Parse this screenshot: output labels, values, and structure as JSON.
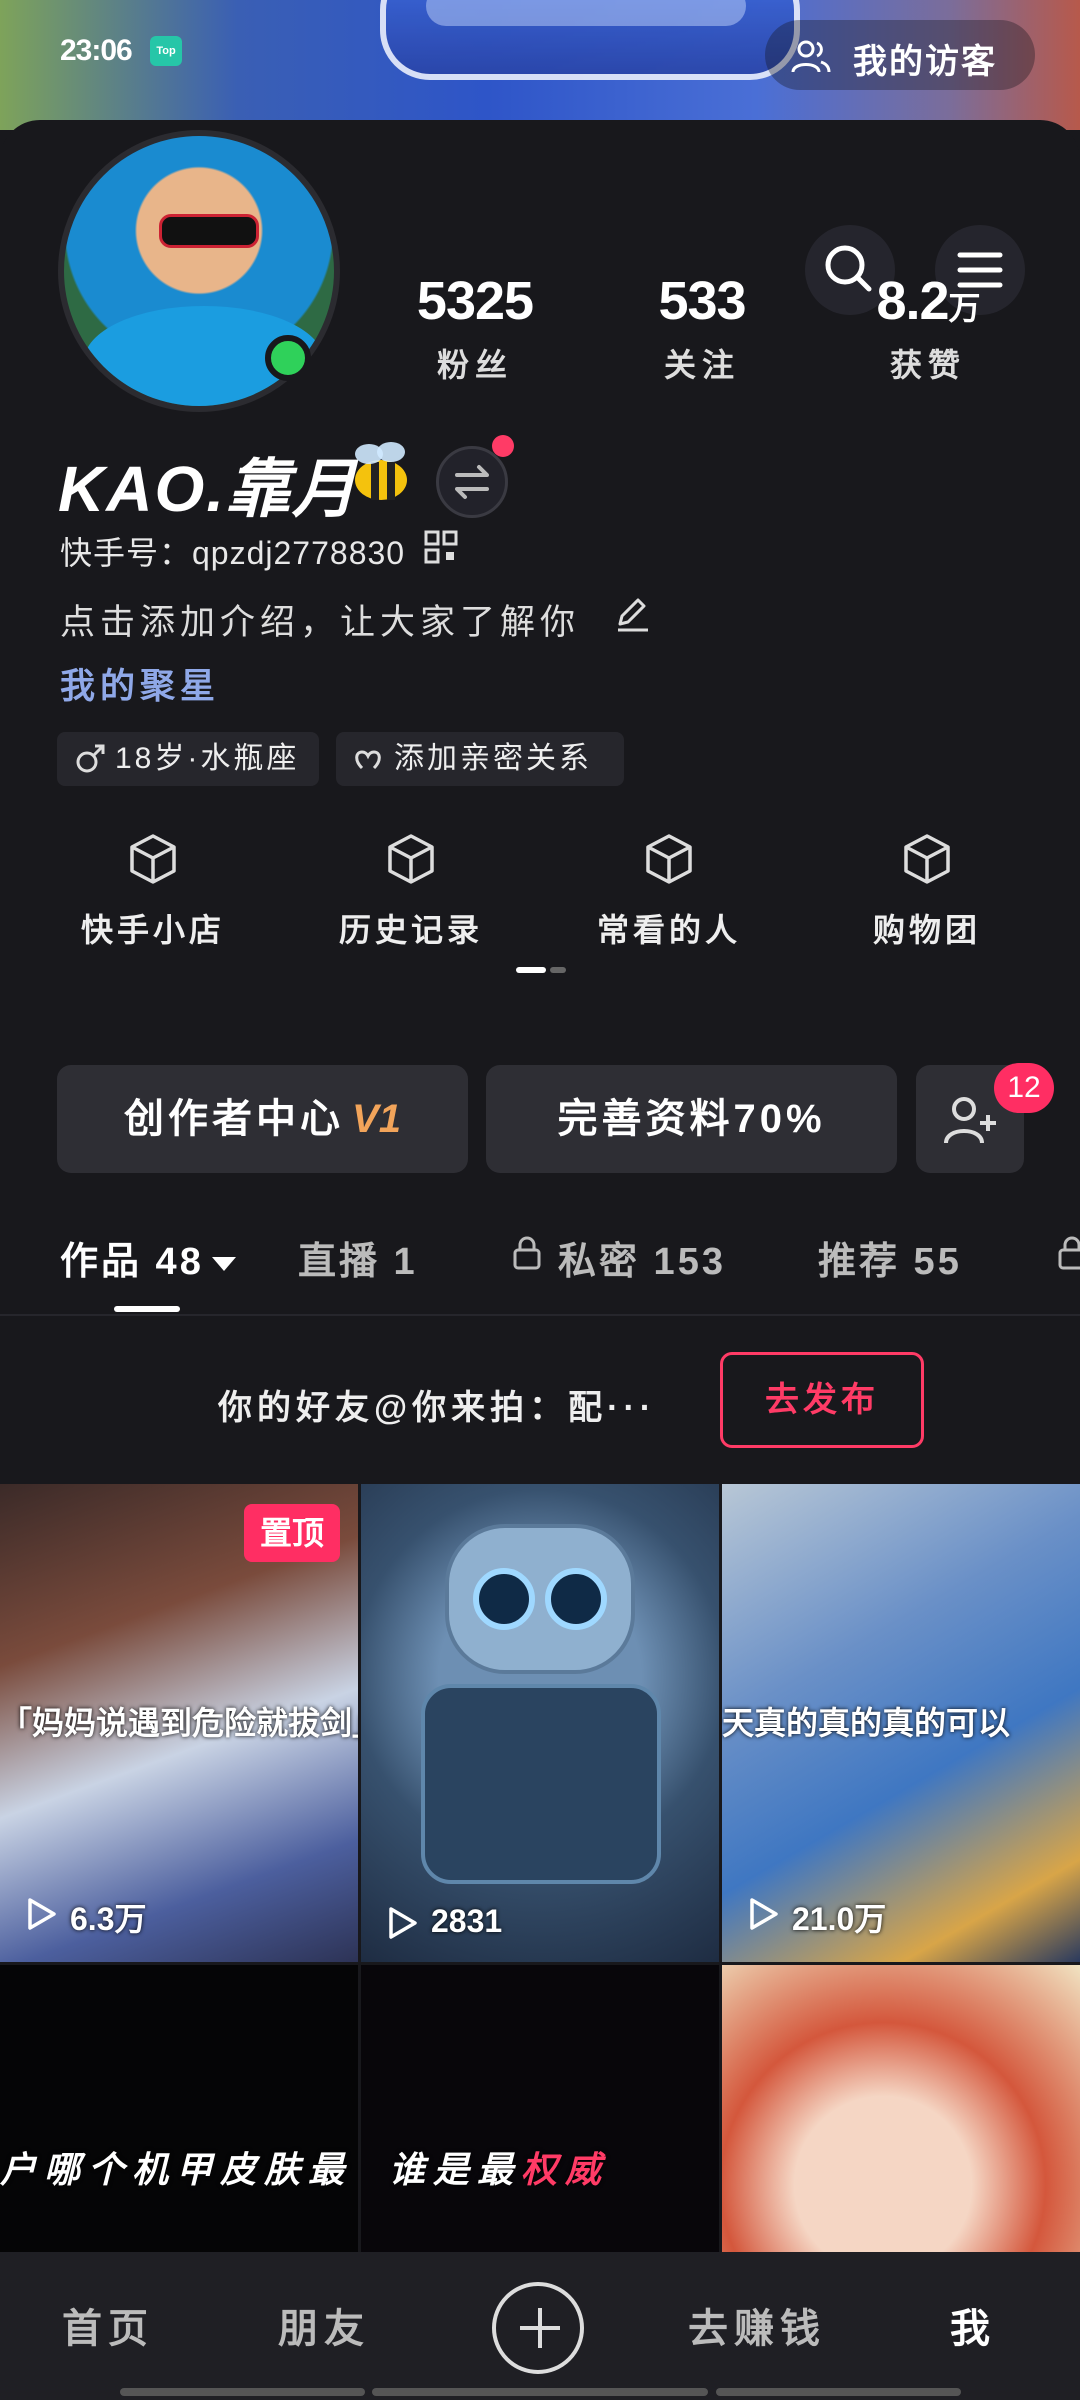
{
  "status_bar": {
    "time": "23:06",
    "app_badge": "Top"
  },
  "visitor": {
    "label": "我的访客"
  },
  "profile": {
    "username": "KAO.靠月",
    "kuaishou_id": "快手号：qpzdj2778830",
    "intro_placeholder": "点击添加介绍，让大家了解你",
    "stars_link": "我的聚星",
    "tags": {
      "age": "18岁·水瓶座",
      "relation": "添加亲密关系"
    }
  },
  "stats": [
    {
      "value": "5325",
      "unit": "",
      "label": "粉丝"
    },
    {
      "value": "533",
      "unit": "",
      "label": "关注"
    },
    {
      "value": "8.2",
      "unit": "万",
      "label": "获赞"
    }
  ],
  "shortcuts": [
    "快手小店",
    "历史记录",
    "常看的人",
    "购物团"
  ],
  "actions": {
    "creator_center": "创作者中心",
    "creator_level": "V1",
    "complete_profile": "完善资料70%",
    "friend_requests_count": "12"
  },
  "tabs": [
    {
      "label": "作品 48",
      "active": true
    },
    {
      "label": "直播 1",
      "active": false
    },
    {
      "label": "私密 153",
      "active": false
    },
    {
      "label": "推荐 55",
      "active": false
    }
  ],
  "invite": {
    "text": "你的好友@你来拍：配···",
    "button": "去发布"
  },
  "videos": [
    {
      "caption": "「妈妈说遇到危险就拔剑」",
      "views": "6.3万",
      "pinned_label": "置顶"
    },
    {
      "caption": "",
      "views": "2831"
    },
    {
      "caption": "天真的真的真的可以",
      "views": "21.0万"
    },
    {
      "caption": "户哪个机甲皮肤最",
      "views": ""
    },
    {
      "caption_prefix": "谁是最",
      "caption_highlight": "权威",
      "views": ""
    },
    {
      "caption": "",
      "views": ""
    }
  ],
  "bottom_nav": {
    "home": "首页",
    "friends": "朋友",
    "earn": "去赚钱",
    "me": "我"
  },
  "colors": {
    "accent": "#ff2e63",
    "background": "#18181c",
    "link": "#8fa8e8",
    "creator_level": "#f2a45a"
  }
}
